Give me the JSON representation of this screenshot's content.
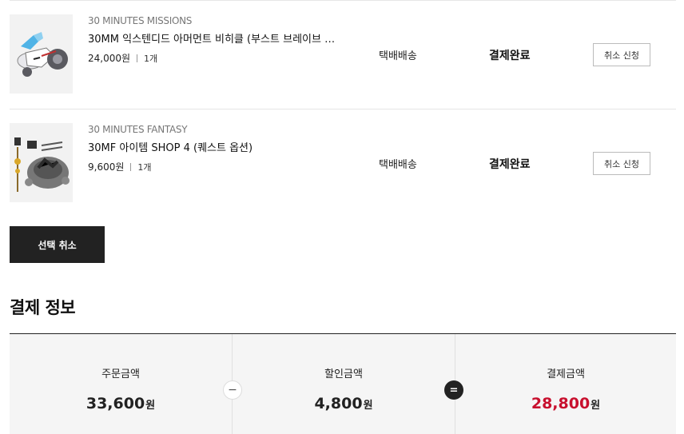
{
  "items": [
    {
      "brand": "30 MINUTES MISSIONS",
      "name": "30MM 익스텐디드 아머먼트 비히클 (부스트 브레이브 …",
      "price": "24,000원",
      "qty": "1개",
      "shipping": "택배배송",
      "status": "결제완료",
      "cancel_label": "취소 신청",
      "thumb_icon": "vehicle-thumbnail-icon"
    },
    {
      "brand": "30 MINUTES FANTASY",
      "name": "30MF 아이템 SHOP 4 (퀘스트 옵션)",
      "price": "9,600원",
      "qty": "1개",
      "shipping": "택배배송",
      "status": "결제완료",
      "cancel_label": "취소 신청",
      "thumb_icon": "item-set-thumbnail-icon"
    }
  ],
  "select_cancel_label": "선택 취소",
  "payment": {
    "title": "결제 정보",
    "order_label": "주문금액",
    "order_amount": "33,600",
    "discount_label": "할인금액",
    "discount_amount": "4,800",
    "final_label": "결제금액",
    "final_amount": "28,800",
    "unit": "원",
    "minus_symbol": "−",
    "equals_symbol": "="
  },
  "colors": {
    "accent_red": "#c8102e",
    "dark": "#222222"
  }
}
